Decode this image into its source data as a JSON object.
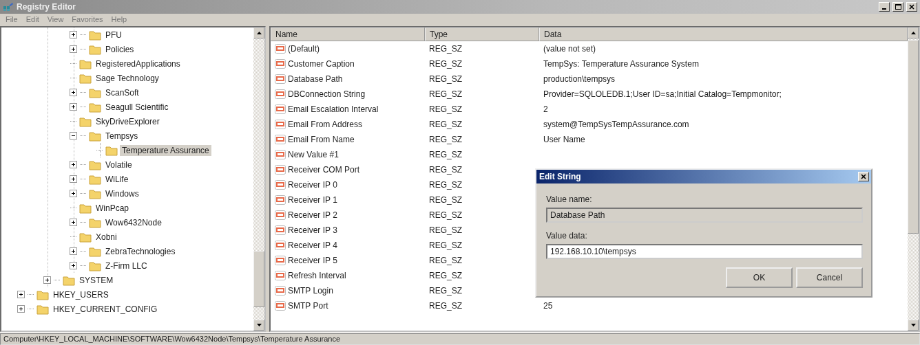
{
  "window": {
    "title": "Registry Editor"
  },
  "menu": [
    "File",
    "Edit",
    "View",
    "Favorites",
    "Help"
  ],
  "tree": [
    {
      "children": [
        {
          "children": [
            {
              "label": "PFU",
              "kind": "collapsed",
              "selected": false
            },
            {
              "label": "Policies",
              "kind": "collapsed",
              "selected": false
            },
            {
              "label": "RegisteredApplications",
              "kind": "leaf",
              "selected": false
            },
            {
              "label": "Sage Technology",
              "kind": "leaf",
              "selected": false
            },
            {
              "label": "ScanSoft",
              "kind": "collapsed",
              "selected": false
            },
            {
              "label": "Seagull Scientific",
              "kind": "collapsed",
              "selected": false
            },
            {
              "label": "SkyDriveExplorer",
              "kind": "leaf",
              "selected": false
            },
            {
              "label": "Tempsys",
              "kind": "expanded",
              "selected": false,
              "children": [
                {
                  "label": "Temperature Assurance",
                  "kind": "leaf",
                  "selected": true
                }
              ]
            },
            {
              "label": "Volatile",
              "kind": "collapsed",
              "selected": false
            },
            {
              "label": "WiLife",
              "kind": "collapsed",
              "selected": false
            },
            {
              "label": "Windows",
              "kind": "collapsed",
              "selected": false
            },
            {
              "label": "WinPcap",
              "kind": "leaf",
              "selected": false
            },
            {
              "label": "Wow6432Node",
              "kind": "collapsed",
              "selected": false
            },
            {
              "label": "Xobni",
              "kind": "leaf",
              "selected": false
            },
            {
              "label": "ZebraTechnologies",
              "kind": "collapsed",
              "selected": false
            },
            {
              "label": "Z-Firm LLC",
              "kind": "collapsed",
              "selected": false
            }
          ]
        },
        {
          "label": "SYSTEM",
          "kind": "collapsed",
          "selected": false
        }
      ]
    },
    {
      "label": "HKEY_USERS",
      "kind": "collapsed",
      "selected": false
    },
    {
      "label": "HKEY_CURRENT_CONFIG",
      "kind": "collapsed",
      "selected": false
    }
  ],
  "table": {
    "columns": [
      "Name",
      "Type",
      "Data"
    ],
    "rows": [
      {
        "name": "(Default)",
        "type": "REG_SZ",
        "data": "(value not set)"
      },
      {
        "name": "Customer Caption",
        "type": "REG_SZ",
        "data": "TempSys: Temperature Assurance System"
      },
      {
        "name": "Database Path",
        "type": "REG_SZ",
        "data": "production\\tempsys"
      },
      {
        "name": "DBConnection String",
        "type": "REG_SZ",
        "data": "Provider=SQLOLEDB.1;User ID=sa;Initial Catalog=Tempmonitor;"
      },
      {
        "name": "Email Escalation Interval",
        "type": "REG_SZ",
        "data": "2"
      },
      {
        "name": "Email From Address",
        "type": "REG_SZ",
        "data": "system@TempSysTempAssurance.com"
      },
      {
        "name": "Email From Name",
        "type": "REG_SZ",
        "data": "User Name"
      },
      {
        "name": "New Value #1",
        "type": "REG_SZ"
      },
      {
        "name": "Receiver COM Port",
        "type": "REG_SZ"
      },
      {
        "name": "Receiver IP 0",
        "type": "REG_SZ"
      },
      {
        "name": "Receiver IP 1",
        "type": "REG_SZ"
      },
      {
        "name": "Receiver IP 2",
        "type": "REG_SZ"
      },
      {
        "name": "Receiver IP 3",
        "type": "REG_SZ"
      },
      {
        "name": "Receiver IP 4",
        "type": "REG_SZ"
      },
      {
        "name": "Receiver IP 5",
        "type": "REG_SZ"
      },
      {
        "name": "Refresh Interval",
        "type": "REG_SZ"
      },
      {
        "name": "SMTP Login",
        "type": "REG_SZ"
      },
      {
        "name": "SMTP Port",
        "type": "REG_SZ",
        "data": "25"
      }
    ]
  },
  "dialog": {
    "title": "Edit String",
    "value_name_label": "Value name:",
    "value_name": "Database Path",
    "value_data_label": "Value data:",
    "value_data": "192.168.10.10\\tempsys",
    "buttons": [
      "OK",
      "Cancel"
    ]
  },
  "status_bar": "Computer\\HKEY_LOCAL_MACHINE\\SOFTWARE\\Wow6432Node\\Tempsys\\Temperature Assurance"
}
